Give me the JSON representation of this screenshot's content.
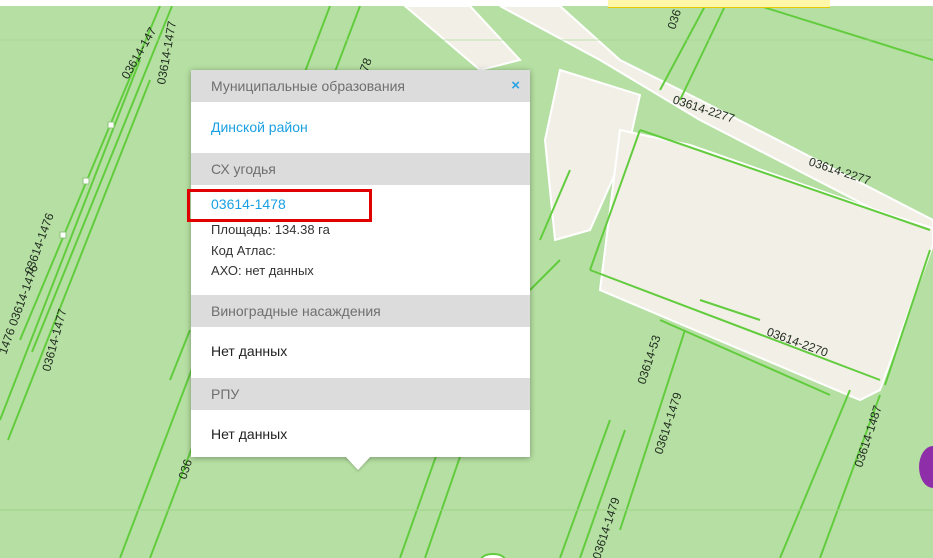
{
  "map": {
    "parcel_labels": [
      "03614-1478",
      "03614-1477",
      "03614-147",
      "03614-1476",
      "1476 03614-1476",
      "03614-1477",
      "03614-2277",
      "03614-2277",
      "03614-2270",
      "03614-53",
      "03614-1479",
      "03614-1487",
      "03614-1479",
      "036",
      "036"
    ]
  },
  "popup": {
    "close_glyph": "×",
    "sections": [
      {
        "header": "Муниципальные образования",
        "link": "Динской район"
      },
      {
        "header": "СХ угодья",
        "parcel_link": "03614-1478",
        "details": [
          "Площадь: 134.38 га",
          "Код Атлас:",
          "АХО: нет данных"
        ]
      },
      {
        "header": "Виноградные насаждения",
        "text": "Нет данных"
      },
      {
        "header": "РПУ",
        "text": "Нет данных"
      }
    ]
  },
  "colors": {
    "parcel_fill": "#b5e0a0",
    "road": "#f1efe6",
    "highlight": "#e00000",
    "link": "#1aa0e2"
  }
}
